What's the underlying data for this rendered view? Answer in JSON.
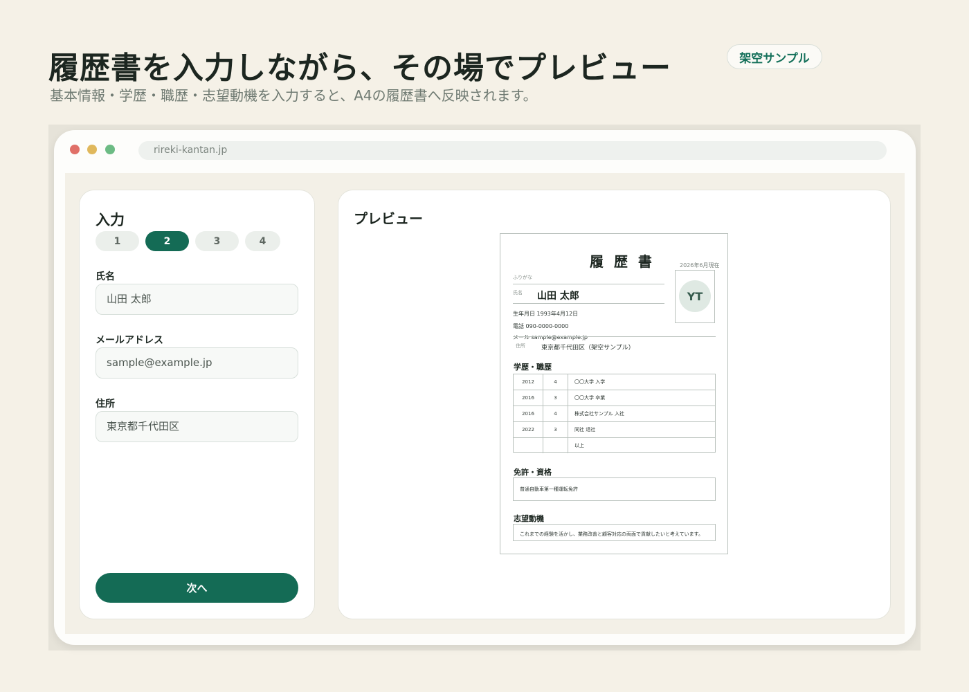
{
  "hero": {
    "title": "履歴書を入力しながら、その場でプレビュー",
    "subtitle": "基本情報・学歴・職歴・志望動機を入力すると、A4の履歴書へ反映されます。",
    "badge": "架空サンプル"
  },
  "browser": {
    "url": "rireki-kantan.jp"
  },
  "input_panel": {
    "heading": "入力",
    "steps": [
      "1",
      "2",
      "3",
      "4"
    ],
    "active_step": "2",
    "fields": [
      {
        "label": "氏名",
        "value": "山田 太郎"
      },
      {
        "label": "メールアドレス",
        "value": "sample@example.jp"
      },
      {
        "label": "住所",
        "value": "東京都千代田区"
      }
    ],
    "next_button": "次へ"
  },
  "preview_panel": {
    "heading": "プレビュー",
    "resume": {
      "title": "履 歴 書",
      "as_of": "2026年6月現在",
      "furigana_label": "ふりがな",
      "name_label": "氏名",
      "name": "山田 太郎",
      "photo_initials": "YT",
      "birth": "生年月日 1993年4月12日",
      "phone": "電話 090-0000-0000",
      "email": "メール sample@example.jp",
      "address_label": "住所",
      "address": "東京都千代田区（架空サンプル）",
      "history_heading": "学歴・職歴",
      "history": [
        {
          "year": "2012",
          "month": "4",
          "desc": "〇〇大学 入学"
        },
        {
          "year": "2016",
          "month": "3",
          "desc": "〇〇大学 卒業"
        },
        {
          "year": "2016",
          "month": "4",
          "desc": "株式会社サンプル 入社"
        },
        {
          "year": "2022",
          "month": "3",
          "desc": "同社 退社"
        },
        {
          "year": "",
          "month": "",
          "desc": "以上"
        }
      ],
      "license_heading": "免許・資格",
      "license": "普通自動車第一種運転免許",
      "motivation_heading": "志望動機",
      "motivation": "これまでの経験を活かし、業務改善と顧客対応の両面で貢献したいと考えています。"
    }
  },
  "colors": {
    "accent": "#146b55",
    "background": "#f5f1e7"
  }
}
